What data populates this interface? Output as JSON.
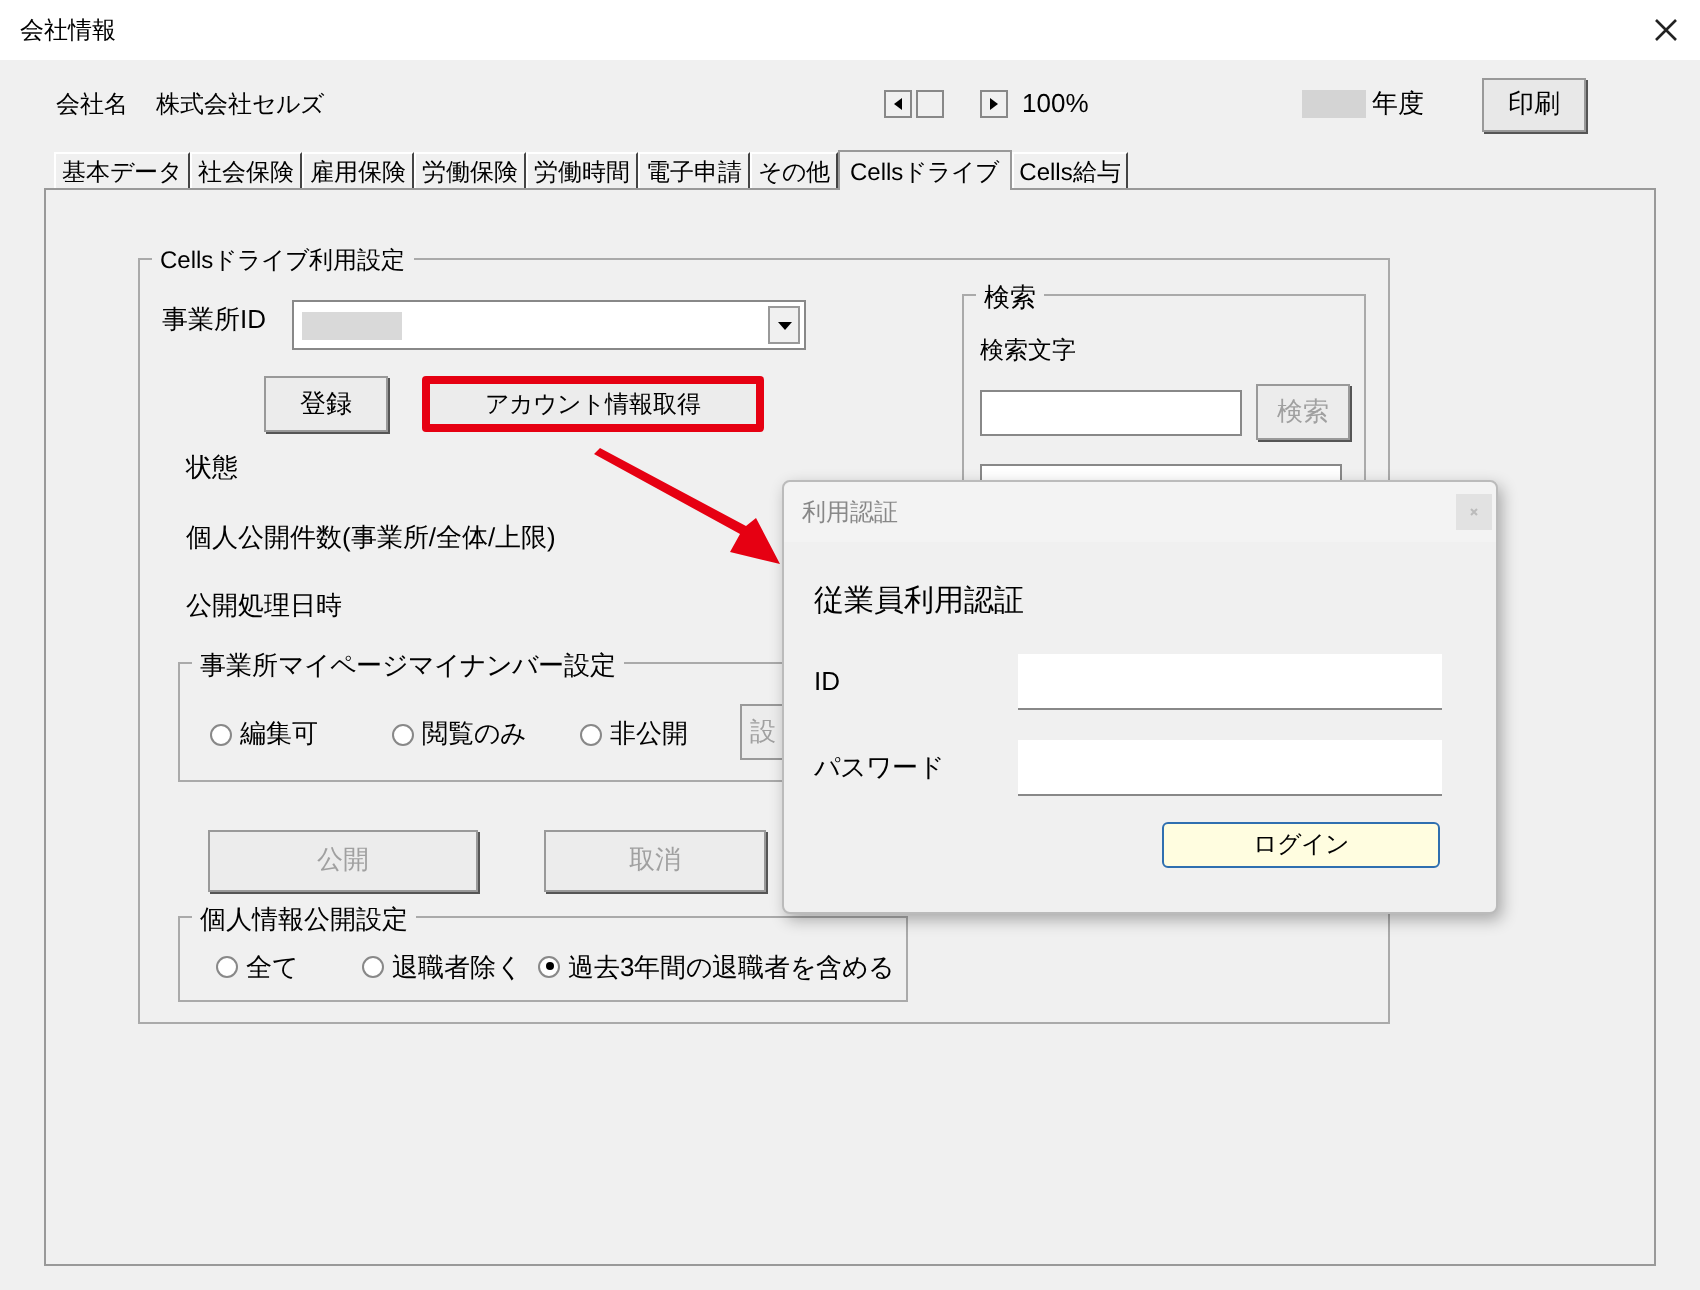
{
  "window": {
    "title": "会社情報"
  },
  "header": {
    "company_label": "会社名",
    "company_name": "株式会社セルズ",
    "zoom": "100%",
    "year_label": "年度",
    "print_button": "印刷"
  },
  "tabs": [
    {
      "label": "基本データ",
      "selected": false
    },
    {
      "label": "社会保険",
      "selected": false
    },
    {
      "label": "雇用保険",
      "selected": false
    },
    {
      "label": "労働保険",
      "selected": false
    },
    {
      "label": "労働時間",
      "selected": false
    },
    {
      "label": "電子申請",
      "selected": false
    },
    {
      "label": "その他",
      "selected": false
    },
    {
      "label": "Cellsドライブ",
      "selected": true
    },
    {
      "label": "Cells給与",
      "selected": false
    }
  ],
  "drive_settings": {
    "title": "Cellsドライブ利用設定",
    "office_id_label": "事業所ID",
    "register_button": "登録",
    "account_button": "アカウント情報取得",
    "status_labels": [
      "状態",
      "個人公開件数(事業所/全体/上限)",
      "公開処理日時"
    ],
    "mynumber": {
      "title": "事業所マイページマイナンバー設定",
      "options": [
        {
          "label": "編集可",
          "selected": false
        },
        {
          "label": "閲覧のみ",
          "selected": false
        },
        {
          "label": "非公開",
          "selected": false
        }
      ],
      "set_button": {
        "label": "設",
        "disabled": true
      }
    },
    "publish_button": {
      "label": "公開",
      "disabled": true
    },
    "cancel_button": {
      "label": "取消",
      "disabled": true
    },
    "personal_info": {
      "title": "個人情報公開設定",
      "options": [
        {
          "label": "全て",
          "selected": false
        },
        {
          "label": "退職者除く",
          "selected": false
        },
        {
          "label": "過去3年間の退職者を含める",
          "selected": true
        }
      ]
    }
  },
  "search": {
    "title": "検索",
    "label": "検索文字",
    "button": {
      "label": "検索",
      "disabled": true
    }
  },
  "dialog": {
    "title": "利用認証",
    "heading": "従業員利用認証",
    "fields": [
      {
        "label": "ID"
      },
      {
        "label": "パスワード"
      }
    ],
    "login_button": "ログイン"
  }
}
